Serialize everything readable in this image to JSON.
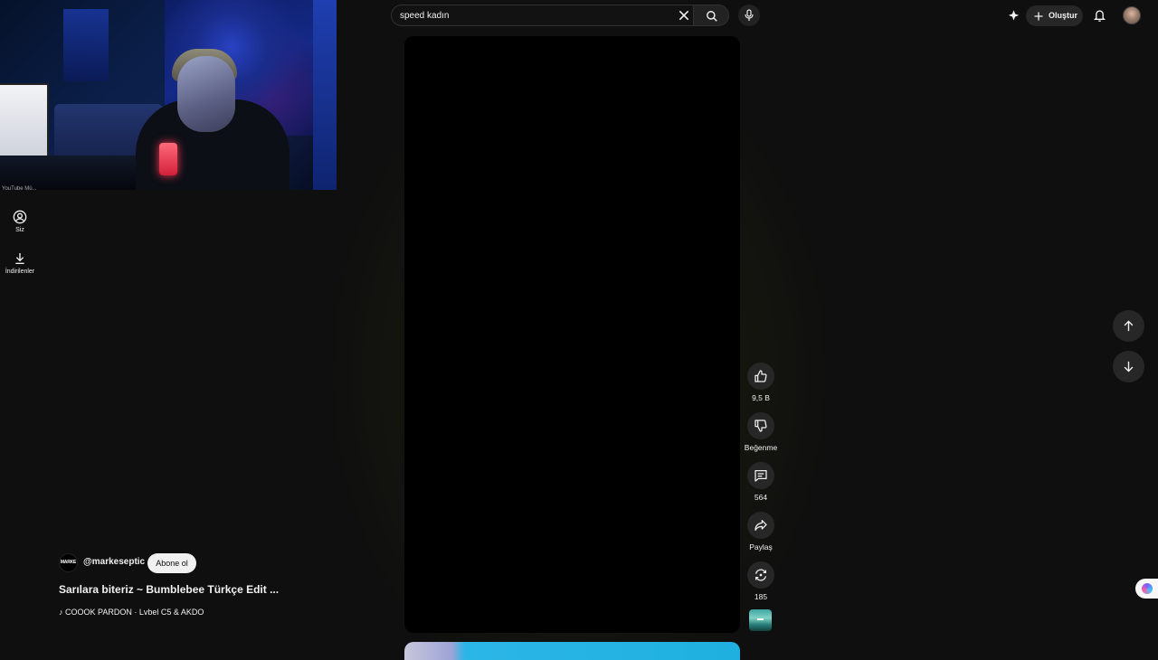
{
  "search": {
    "query": "speed kadın"
  },
  "header": {
    "create_label": "Oluştur"
  },
  "sidebar": {
    "cropped_label": "YouTube Mü...",
    "items": [
      {
        "label": "Siz",
        "icon": "account-circle-icon"
      },
      {
        "label": "İndirilenler",
        "icon": "download-icon"
      }
    ]
  },
  "short": {
    "channel_handle": "@markeseptic",
    "channel_avatar_text": "MARKE",
    "subscribe_label": "Abone ol",
    "title": "Sarılara biteriz ~ Bumblebee Türkçe Edit ...",
    "music": "COOOK PARDON · Lvbel C5 & AKDO"
  },
  "actions": {
    "like_count": "9,5 B",
    "dislike_label": "Beğenme",
    "comment_count": "564",
    "share_label": "Paylaş",
    "remix_count": "185"
  },
  "colors": {
    "background": "#0f0f0f",
    "button_bg": "#272727",
    "subscribe_bg": "#f1f1f1"
  }
}
